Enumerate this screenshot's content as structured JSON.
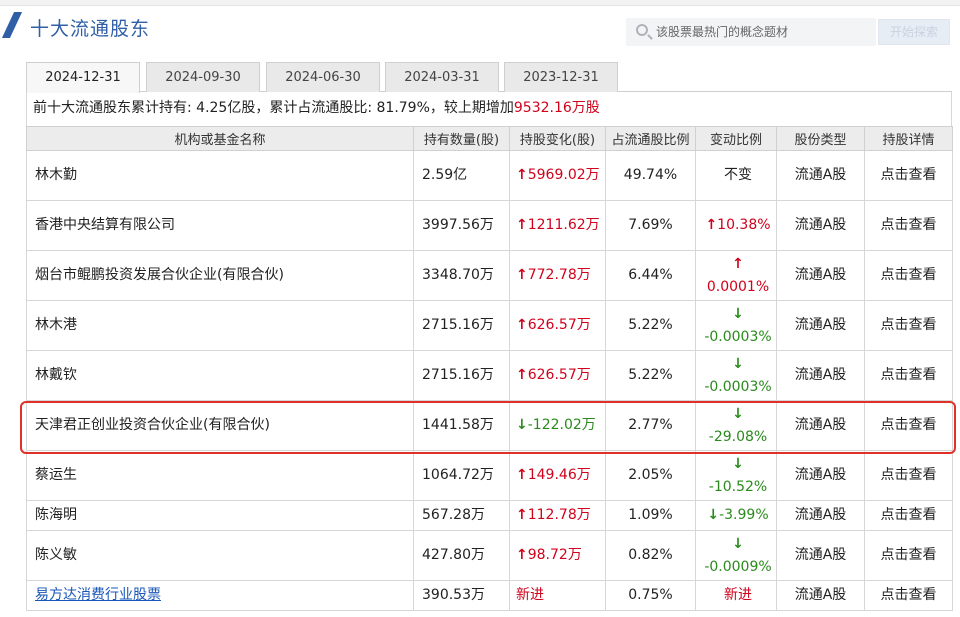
{
  "section_title": "十大流通股东",
  "search": {
    "placeholder": "该股票最热门的概念题材",
    "button_label": "开始探索"
  },
  "tabs": [
    {
      "label": "2024-12-31",
      "active": true
    },
    {
      "label": "2024-09-30",
      "active": false
    },
    {
      "label": "2024-06-30",
      "active": false
    },
    {
      "label": "2024-03-31",
      "active": false
    },
    {
      "label": "2023-12-31",
      "active": false
    }
  ],
  "summary": {
    "prefix": "前十大流通股东累计持有: 4.25亿股，累计占流通股比: 81.79%，较上期增加",
    "increase": "9532.16万股"
  },
  "columns": [
    "机构或基金名称",
    "持有数量(股)",
    "持股变化(股)",
    "占流通股比例",
    "变动比例",
    "股份类型",
    "持股详情"
  ],
  "rows": [
    {
      "name": "林木勤",
      "qty": "2.59亿",
      "change": "5969.02万",
      "change_dir": "up",
      "ratio": "49.74%",
      "vchg": "不变",
      "vchg_dir": "none",
      "type": "流通A股",
      "detail": "点击查看"
    },
    {
      "name": "香港中央结算有限公司",
      "qty": "3997.56万",
      "change": "1211.62万",
      "change_dir": "up",
      "ratio": "7.69%",
      "vchg": "10.38%",
      "vchg_dir": "up",
      "type": "流通A股",
      "detail": "点击查看"
    },
    {
      "name": "烟台市鲲鹏投资发展合伙企业(有限合伙)",
      "qty": "3348.70万",
      "change": "772.78万",
      "change_dir": "up",
      "ratio": "6.44%",
      "vchg": "0.0001%",
      "vchg_dir": "up",
      "type": "流通A股",
      "detail": "点击查看"
    },
    {
      "name": "林木港",
      "qty": "2715.16万",
      "change": "626.57万",
      "change_dir": "up",
      "ratio": "5.22%",
      "vchg": "-0.0003%",
      "vchg_dir": "down",
      "type": "流通A股",
      "detail": "点击查看"
    },
    {
      "name": "林戴钦",
      "qty": "2715.16万",
      "change": "626.57万",
      "change_dir": "up",
      "ratio": "5.22%",
      "vchg": "-0.0003%",
      "vchg_dir": "down",
      "type": "流通A股",
      "detail": "点击查看"
    },
    {
      "name": "天津君正创业投资合伙企业(有限合伙)",
      "qty": "1441.58万",
      "change": "-122.02万",
      "change_dir": "down",
      "ratio": "2.77%",
      "vchg": "-29.08%",
      "vchg_dir": "down",
      "type": "流通A股",
      "detail": "点击查看"
    },
    {
      "name": "蔡运生",
      "qty": "1064.72万",
      "change": "149.46万",
      "change_dir": "up",
      "ratio": "2.05%",
      "vchg": "-10.52%",
      "vchg_dir": "down",
      "type": "流通A股",
      "detail": "点击查看"
    },
    {
      "name": "陈海明",
      "qty": "567.28万",
      "change": "112.78万",
      "change_dir": "up",
      "ratio": "1.09%",
      "vchg": "-3.99%",
      "vchg_dir": "down",
      "type": "流通A股",
      "detail": "点击查看"
    },
    {
      "name": "陈义敏",
      "qty": "427.80万",
      "change": "98.72万",
      "change_dir": "up",
      "ratio": "0.82%",
      "vchg": "-0.0009%",
      "vchg_dir": "down",
      "type": "流通A股",
      "detail": "点击查看"
    },
    {
      "name": "易方达消费行业股票",
      "name_link": true,
      "qty": "390.53万",
      "change": "新进",
      "change_dir": "new",
      "ratio": "0.75%",
      "vchg": "新进",
      "vchg_dir": "new",
      "type": "流通A股",
      "detail": "点击查看"
    }
  ],
  "highlight_row_index": 5,
  "colors": {
    "accent": "#2f5fa6",
    "up": "#d0021b",
    "down": "#2a8a1c",
    "link": "#1a56b8",
    "highlight": "#e0302a"
  }
}
